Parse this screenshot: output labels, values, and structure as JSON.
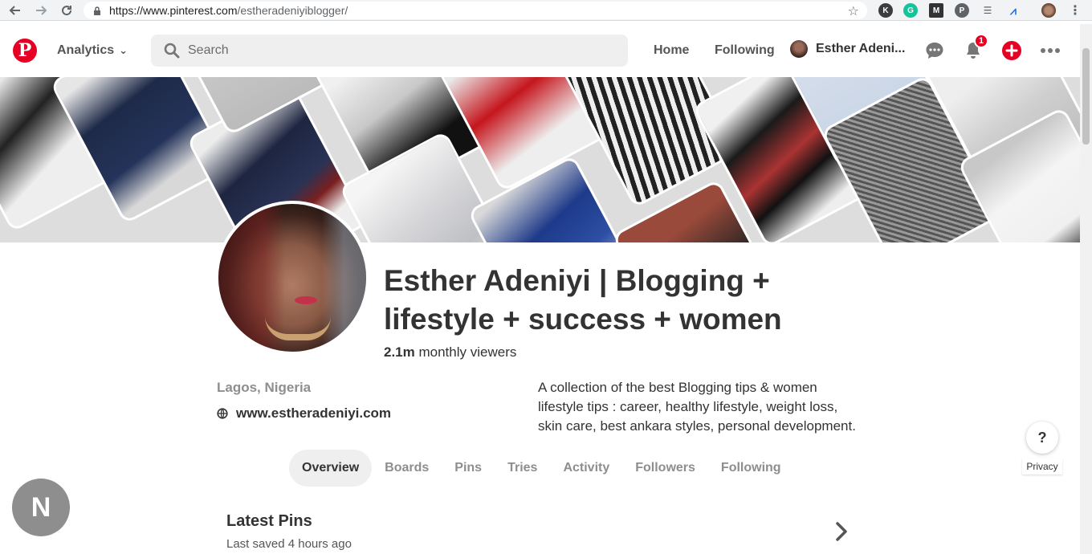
{
  "browser": {
    "url_host": "https://www.pinterest.com",
    "url_path": "/estheradeniyiblogger/"
  },
  "header": {
    "logo_text": "P",
    "analytics_label": "Analytics",
    "search_placeholder": "Search",
    "nav_home": "Home",
    "nav_following": "Following",
    "profile_name": "Esther Adeni...",
    "notification_count": "1",
    "brand_color": "#e60023"
  },
  "profile": {
    "name": "Esther Adeniyi | Blogging + lifestyle + success + women",
    "viewers_count": "2.1m",
    "viewers_label": "monthly viewers",
    "location": "Lagos, Nigeria",
    "website": "www.estheradeniyi.com",
    "bio": "A collection of the best Blogging tips & women lifestyle tips : career, healthy lifestyle, weight loss, skin care, best ankara styles, personal development."
  },
  "tabs": [
    {
      "label": "Overview",
      "active": true
    },
    {
      "label": "Boards",
      "active": false
    },
    {
      "label": "Pins",
      "active": false
    },
    {
      "label": "Tries",
      "active": false
    },
    {
      "label": "Activity",
      "active": false
    },
    {
      "label": "Followers",
      "active": false
    },
    {
      "label": "Following",
      "active": false
    }
  ],
  "help": {
    "label": "?",
    "privacy": "Privacy"
  },
  "user_initial": "N",
  "latest": {
    "title": "Latest Pins",
    "subtitle": "Last saved 4 hours ago"
  }
}
